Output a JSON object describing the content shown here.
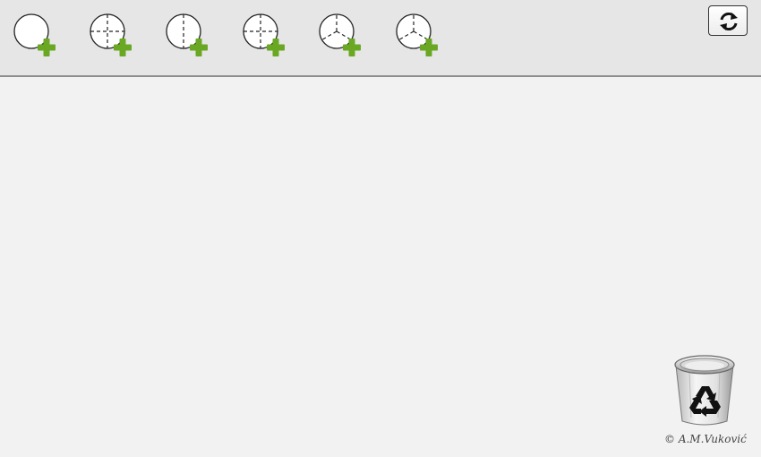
{
  "toolbar": {
    "tools": [
      {
        "name": "add-blank-circle",
        "icon": "blank-circle-plus-icon"
      },
      {
        "name": "add-quartered-circle",
        "icon": "quartered-circle-plus-icon"
      },
      {
        "name": "add-halved-circle",
        "icon": "halved-circle-plus-icon"
      },
      {
        "name": "add-quartered-circle-2",
        "icon": "quartered-circle-plus-icon"
      },
      {
        "name": "add-thirds-circle",
        "icon": "thirds-circle-plus-icon"
      },
      {
        "name": "add-thirds-circle-2",
        "icon": "thirds-circle-plus-icon"
      }
    ],
    "refresh_icon": "refresh-icon"
  },
  "trash": {
    "icon": "recycle-bin-icon"
  },
  "credit": "© A.M.Vuković",
  "colors": {
    "toolbar_bg": "#e6e6e6",
    "workspace_bg": "#f2f2f2",
    "plus_green": "#6aa823"
  }
}
